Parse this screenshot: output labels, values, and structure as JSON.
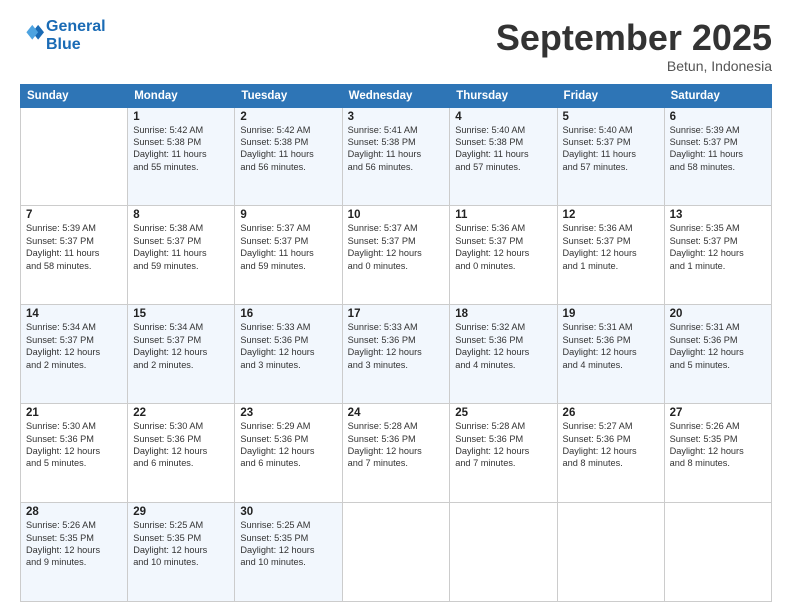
{
  "header": {
    "logo_line1": "General",
    "logo_line2": "Blue",
    "month_title": "September 2025",
    "location": "Betun, Indonesia"
  },
  "weekdays": [
    "Sunday",
    "Monday",
    "Tuesday",
    "Wednesday",
    "Thursday",
    "Friday",
    "Saturday"
  ],
  "weeks": [
    [
      {
        "num": "",
        "info": ""
      },
      {
        "num": "1",
        "info": "Sunrise: 5:42 AM\nSunset: 5:38 PM\nDaylight: 11 hours\nand 55 minutes."
      },
      {
        "num": "2",
        "info": "Sunrise: 5:42 AM\nSunset: 5:38 PM\nDaylight: 11 hours\nand 56 minutes."
      },
      {
        "num": "3",
        "info": "Sunrise: 5:41 AM\nSunset: 5:38 PM\nDaylight: 11 hours\nand 56 minutes."
      },
      {
        "num": "4",
        "info": "Sunrise: 5:40 AM\nSunset: 5:38 PM\nDaylight: 11 hours\nand 57 minutes."
      },
      {
        "num": "5",
        "info": "Sunrise: 5:40 AM\nSunset: 5:37 PM\nDaylight: 11 hours\nand 57 minutes."
      },
      {
        "num": "6",
        "info": "Sunrise: 5:39 AM\nSunset: 5:37 PM\nDaylight: 11 hours\nand 58 minutes."
      }
    ],
    [
      {
        "num": "7",
        "info": "Sunrise: 5:39 AM\nSunset: 5:37 PM\nDaylight: 11 hours\nand 58 minutes."
      },
      {
        "num": "8",
        "info": "Sunrise: 5:38 AM\nSunset: 5:37 PM\nDaylight: 11 hours\nand 59 minutes."
      },
      {
        "num": "9",
        "info": "Sunrise: 5:37 AM\nSunset: 5:37 PM\nDaylight: 11 hours\nand 59 minutes."
      },
      {
        "num": "10",
        "info": "Sunrise: 5:37 AM\nSunset: 5:37 PM\nDaylight: 12 hours\nand 0 minutes."
      },
      {
        "num": "11",
        "info": "Sunrise: 5:36 AM\nSunset: 5:37 PM\nDaylight: 12 hours\nand 0 minutes."
      },
      {
        "num": "12",
        "info": "Sunrise: 5:36 AM\nSunset: 5:37 PM\nDaylight: 12 hours\nand 1 minute."
      },
      {
        "num": "13",
        "info": "Sunrise: 5:35 AM\nSunset: 5:37 PM\nDaylight: 12 hours\nand 1 minute."
      }
    ],
    [
      {
        "num": "14",
        "info": "Sunrise: 5:34 AM\nSunset: 5:37 PM\nDaylight: 12 hours\nand 2 minutes."
      },
      {
        "num": "15",
        "info": "Sunrise: 5:34 AM\nSunset: 5:37 PM\nDaylight: 12 hours\nand 2 minutes."
      },
      {
        "num": "16",
        "info": "Sunrise: 5:33 AM\nSunset: 5:36 PM\nDaylight: 12 hours\nand 3 minutes."
      },
      {
        "num": "17",
        "info": "Sunrise: 5:33 AM\nSunset: 5:36 PM\nDaylight: 12 hours\nand 3 minutes."
      },
      {
        "num": "18",
        "info": "Sunrise: 5:32 AM\nSunset: 5:36 PM\nDaylight: 12 hours\nand 4 minutes."
      },
      {
        "num": "19",
        "info": "Sunrise: 5:31 AM\nSunset: 5:36 PM\nDaylight: 12 hours\nand 4 minutes."
      },
      {
        "num": "20",
        "info": "Sunrise: 5:31 AM\nSunset: 5:36 PM\nDaylight: 12 hours\nand 5 minutes."
      }
    ],
    [
      {
        "num": "21",
        "info": "Sunrise: 5:30 AM\nSunset: 5:36 PM\nDaylight: 12 hours\nand 5 minutes."
      },
      {
        "num": "22",
        "info": "Sunrise: 5:30 AM\nSunset: 5:36 PM\nDaylight: 12 hours\nand 6 minutes."
      },
      {
        "num": "23",
        "info": "Sunrise: 5:29 AM\nSunset: 5:36 PM\nDaylight: 12 hours\nand 6 minutes."
      },
      {
        "num": "24",
        "info": "Sunrise: 5:28 AM\nSunset: 5:36 PM\nDaylight: 12 hours\nand 7 minutes."
      },
      {
        "num": "25",
        "info": "Sunrise: 5:28 AM\nSunset: 5:36 PM\nDaylight: 12 hours\nand 7 minutes."
      },
      {
        "num": "26",
        "info": "Sunrise: 5:27 AM\nSunset: 5:36 PM\nDaylight: 12 hours\nand 8 minutes."
      },
      {
        "num": "27",
        "info": "Sunrise: 5:26 AM\nSunset: 5:35 PM\nDaylight: 12 hours\nand 8 minutes."
      }
    ],
    [
      {
        "num": "28",
        "info": "Sunrise: 5:26 AM\nSunset: 5:35 PM\nDaylight: 12 hours\nand 9 minutes."
      },
      {
        "num": "29",
        "info": "Sunrise: 5:25 AM\nSunset: 5:35 PM\nDaylight: 12 hours\nand 10 minutes."
      },
      {
        "num": "30",
        "info": "Sunrise: 5:25 AM\nSunset: 5:35 PM\nDaylight: 12 hours\nand 10 minutes."
      },
      {
        "num": "",
        "info": ""
      },
      {
        "num": "",
        "info": ""
      },
      {
        "num": "",
        "info": ""
      },
      {
        "num": "",
        "info": ""
      }
    ]
  ]
}
